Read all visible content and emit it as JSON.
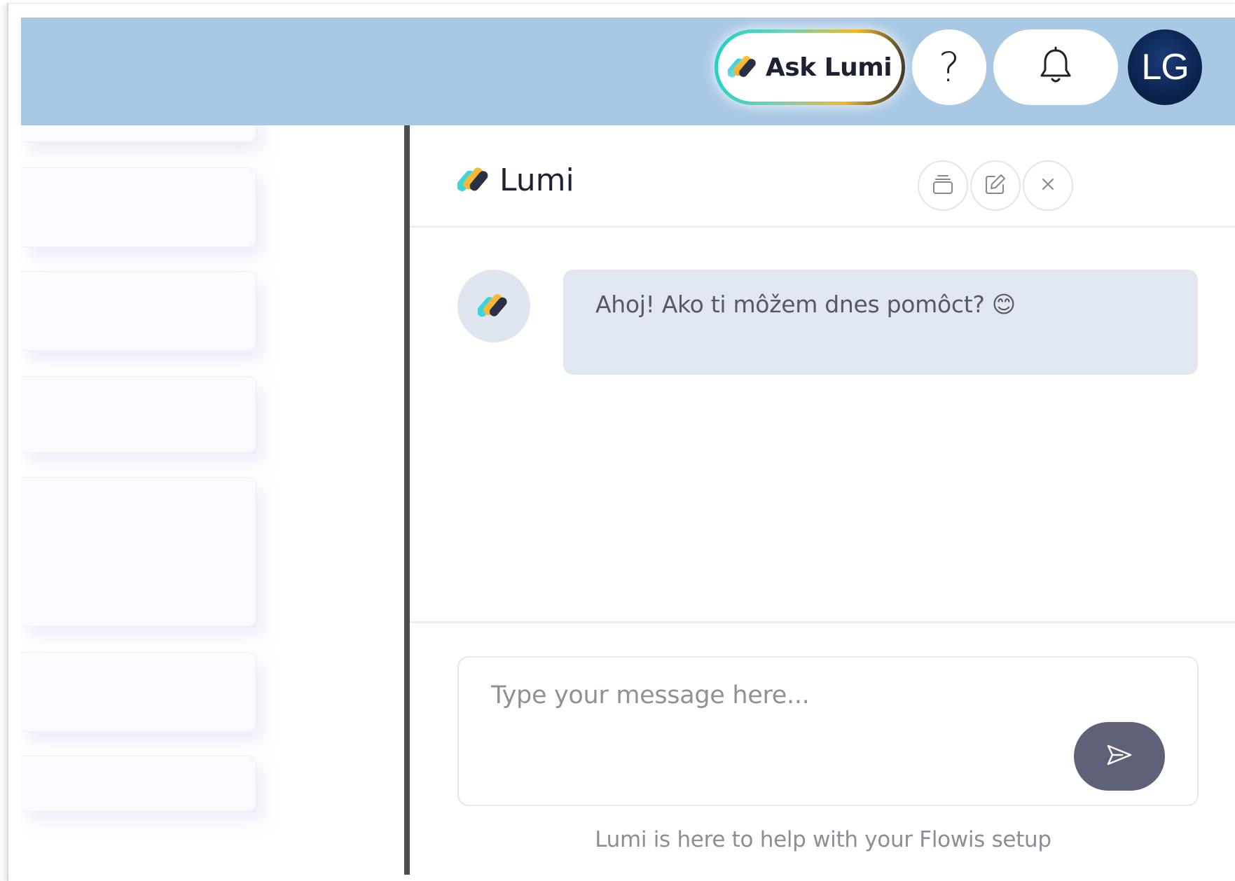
{
  "header": {
    "ask_button_label": "Ask Lumi",
    "help_label": "?",
    "avatar_initials": "LG",
    "bar_color": "#a9c8e3",
    "avatar_color": "#0c2350"
  },
  "chat": {
    "title": "Lumi",
    "header_buttons": [
      "archive-icon",
      "edit-icon",
      "close-icon"
    ],
    "messages": [
      {
        "sender": "bot",
        "text": "Ahoj! Ako ti môžem dnes pomôct? 😊"
      }
    ],
    "input_placeholder": "Type your message here...",
    "send_icon": "send-icon",
    "helper_text": "Lumi is here to help with your Flowis setup",
    "send_button_color": "#5e6178",
    "bubble_color": "#e1e8f2"
  }
}
